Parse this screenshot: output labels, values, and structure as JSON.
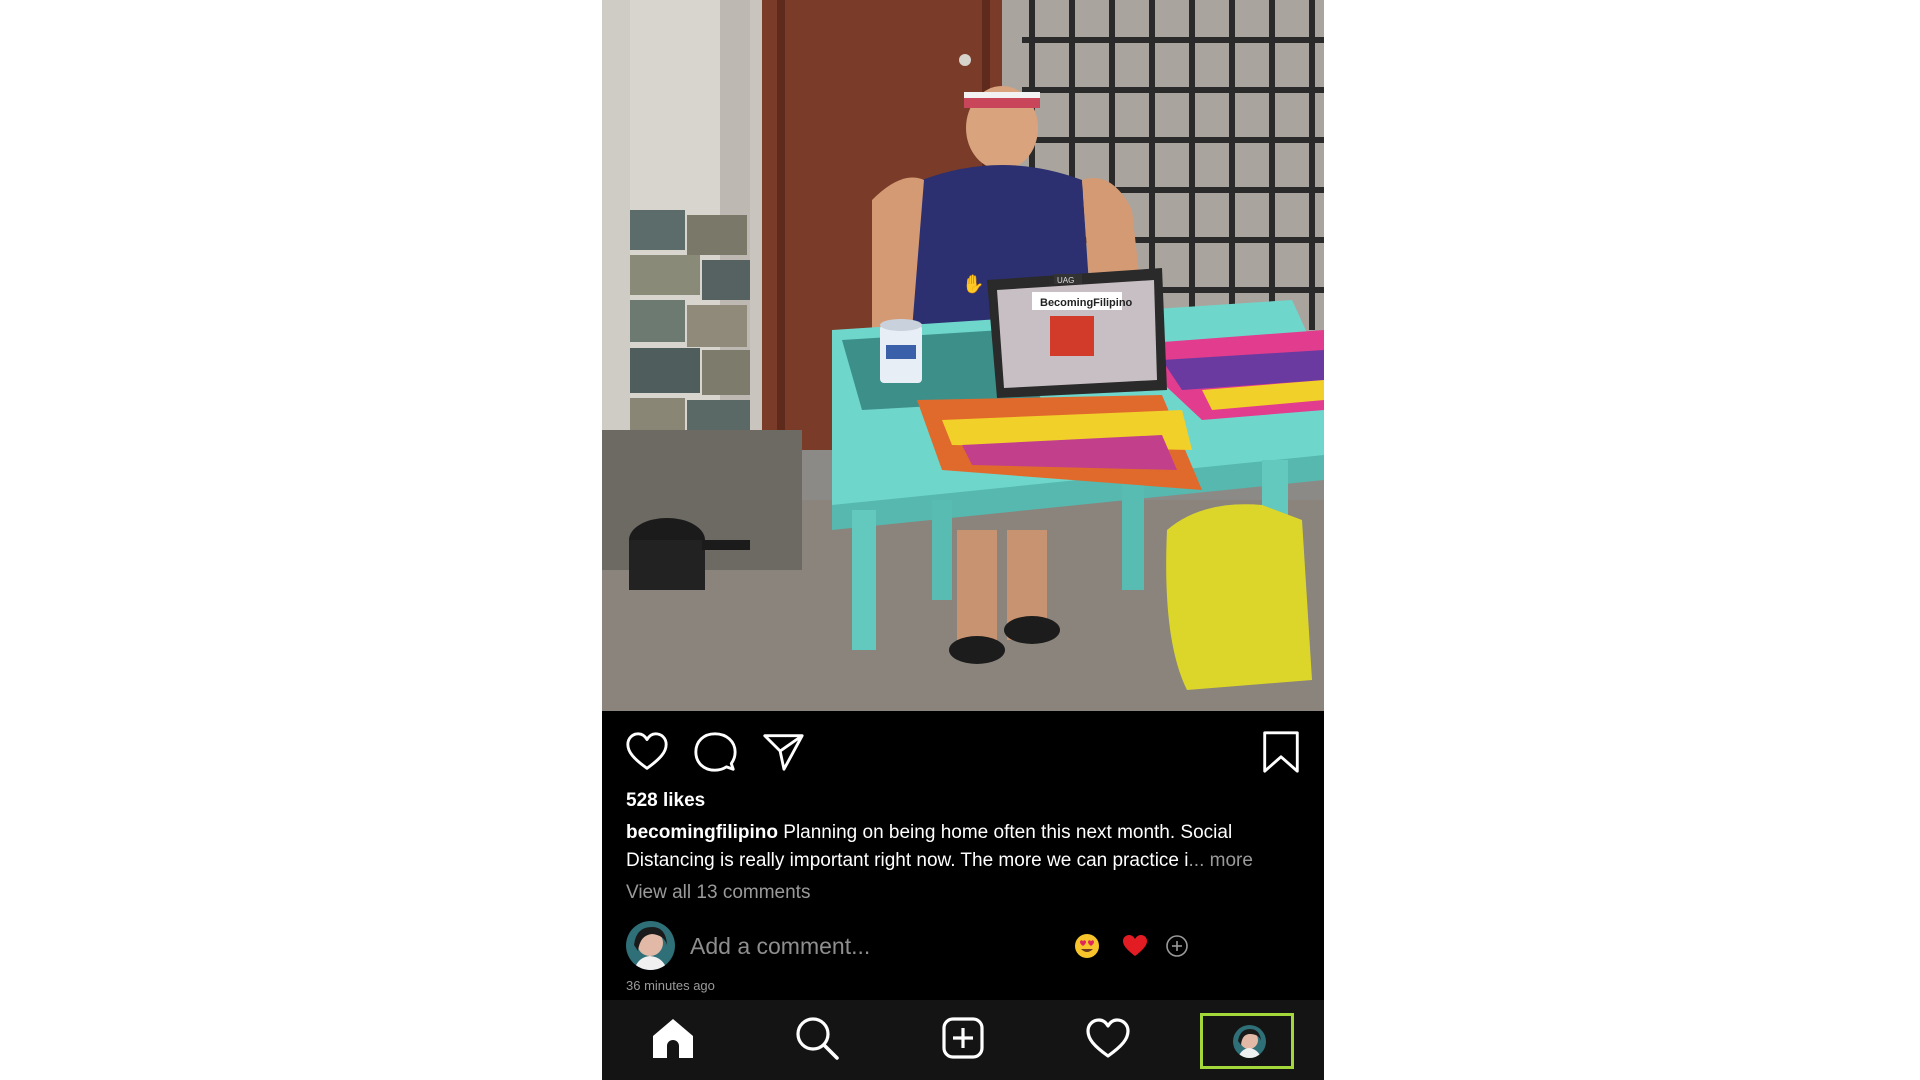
{
  "post": {
    "likes": "528 likes",
    "username": "becomingfilipino",
    "caption_text": "Planning on being home often this next month.  Social Distancing is really important right now.  The more we can practice i",
    "ellipsis_more": "... more",
    "view_comments": "View all 13 comments",
    "timestamp": "36 minutes ago"
  },
  "comment_box": {
    "placeholder": "Add a comment..."
  },
  "actions": {
    "icons": [
      "heart-icon",
      "comment-icon",
      "send-icon",
      "bookmark-icon"
    ]
  },
  "quick_reactions": [
    "heart-eyes-emoji",
    "red-heart-emoji",
    "plus-circle-icon"
  ],
  "nav": {
    "items": [
      "home-icon",
      "search-icon",
      "new-post-icon",
      "activity-heart-icon",
      "profile-avatar"
    ],
    "active": "profile-avatar",
    "highlight_color": "#a4d83a"
  },
  "colors": {
    "background": "#000000",
    "nav_background": "#141414",
    "muted_text": "#9a9a9a",
    "table_teal": "#6fd6cc"
  },
  "photo": {
    "laptop_sticker_text": "BecomingFilipino",
    "laptop_brand": "UAG"
  }
}
